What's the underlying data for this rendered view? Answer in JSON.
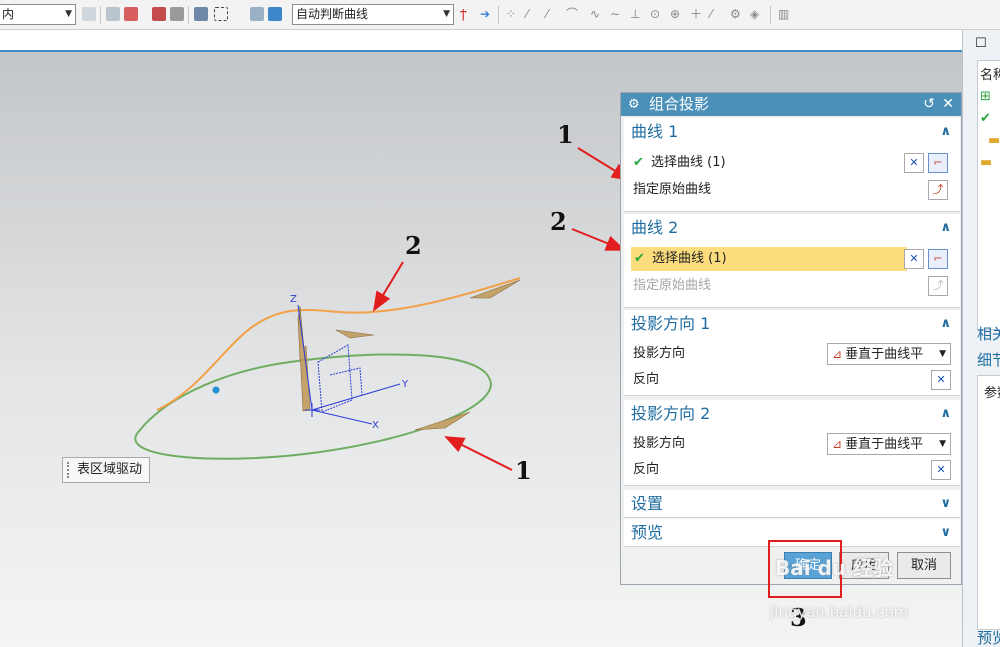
{
  "toolbar": {
    "snap_filter_value": "内",
    "curve_rule_value": "自动判断曲线"
  },
  "viewport": {
    "surface_drive_label": "表区域驱动",
    "axes": {
      "z": "Z",
      "y": "Y",
      "x": "X"
    }
  },
  "dialog": {
    "title": "组合投影",
    "sections": {
      "curve1": {
        "title": "曲线 1",
        "select_curve": "选择曲线 (1)",
        "specify_original": "指定原始曲线"
      },
      "curve2": {
        "title": "曲线 2",
        "select_curve": "选择曲线 (1)",
        "specify_original": "指定原始曲线"
      },
      "proj_dir1": {
        "title": "投影方向 1",
        "direction_label": "投影方向",
        "direction_value": "垂直于曲线平",
        "reverse_label": "反向"
      },
      "proj_dir2": {
        "title": "投影方向 2",
        "direction_label": "投影方向",
        "direction_value": "垂直于曲线平",
        "reverse_label": "反向"
      },
      "settings": {
        "title": "设置"
      },
      "preview": {
        "title": "预览"
      }
    },
    "buttons": {
      "ok": "确定",
      "apply": "应用",
      "cancel": "取消"
    }
  },
  "annotations": {
    "num1_top": "1",
    "num2_top": "2",
    "num2_curve": "2",
    "num1_curve": "1",
    "num3": "3",
    "color": "#e11d1d"
  },
  "watermark": {
    "brand": "Bai du 经验",
    "url": "jingyan.baidu.com"
  },
  "right_panel": {
    "name_header": "名称",
    "related_label": "相关",
    "detail_label": "细节",
    "param_label": "参数",
    "preview_label": "预览"
  },
  "colors": {
    "accent": "#4a90b8",
    "orange_curve": "#f3a148",
    "green_curve": "#6fae62",
    "highlight_row": "#fcdd7e"
  }
}
